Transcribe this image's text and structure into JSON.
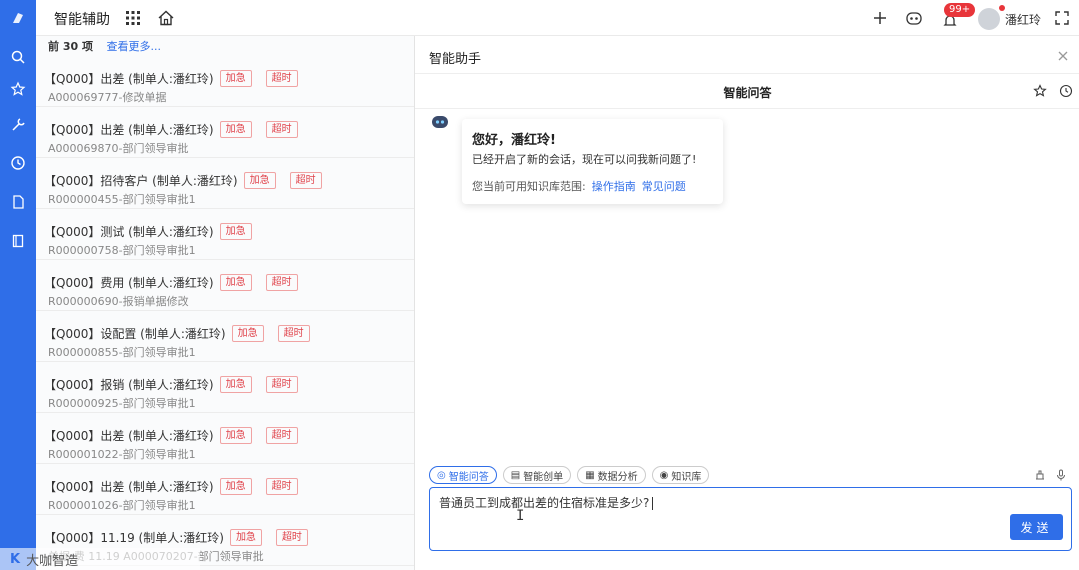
{
  "header": {
    "app_title": "智能辅助",
    "badge": "99+",
    "user_name": "潘红玲"
  },
  "list": {
    "count_label": "前 30 项",
    "more_label": "查看更多...",
    "rows": [
      {
        "title": "【Q000】出差 (制单人:潘红玲)",
        "tags": [
          "加急",
          "超时"
        ],
        "sub": "A000069777-修改单据"
      },
      {
        "title": "【Q000】出差 (制单人:潘红玲)",
        "tags": [
          "加急",
          "超时"
        ],
        "sub": "A000069870-部门领导审批"
      },
      {
        "title": "【Q000】招待客户 (制单人:潘红玲)",
        "tags": [
          "加急",
          "超时"
        ],
        "sub": "R000000455-部门领导审批1"
      },
      {
        "title": "【Q000】测试 (制单人:潘红玲)",
        "tags": [
          "加急"
        ],
        "sub": "R000000758-部门领导审批1"
      },
      {
        "title": "【Q000】费用 (制单人:潘红玲)",
        "tags": [
          "加急",
          "超时"
        ],
        "sub": "R000000690-报销单据修改"
      },
      {
        "title": "【Q000】设配置 (制单人:潘红玲)",
        "tags": [
          "加急",
          "超时"
        ],
        "sub": "R000000855-部门领导审批1"
      },
      {
        "title": "【Q000】报销 (制单人:潘红玲)",
        "tags": [
          "加急",
          "超时"
        ],
        "sub": "R000000925-部门领导审批1"
      },
      {
        "title": "【Q000】出差 (制单人:潘红玲)",
        "tags": [
          "加急",
          "超时"
        ],
        "sub": "R000001022-部门领导审批1"
      },
      {
        "title": "【Q000】出差 (制单人:潘红玲)",
        "tags": [
          "加急",
          "超时"
        ],
        "sub": "R000001026-部门领导审批1"
      },
      {
        "title": "【Q000】11.19 (制单人:潘红玲)",
        "tags": [
          "加急",
          "超时"
        ],
        "sub": "单据:费 11.19 A000070207-部门领导审批"
      }
    ]
  },
  "assistant": {
    "panel_title": "智能助手",
    "qa_title": "智能问答",
    "greeting": "您好，潘红玲!",
    "message": "已经开启了新的会话，现在可以问我新问题了!",
    "scope_label": "您当前可用知识库范围:",
    "scope_links": [
      "操作指南",
      "常见问题"
    ],
    "tools": [
      "智能问答",
      "智能创单",
      "数据分析",
      "知识库"
    ],
    "input_value": "普通员工到成都出差的住宿标准是多少?",
    "send_label": "发送"
  },
  "watermark": {
    "logo": "K",
    "text": "大咖智造"
  },
  "colors": {
    "accent": "#2f6ee8",
    "tag_red": "#e0424a",
    "badge_red": "#e8353a"
  }
}
